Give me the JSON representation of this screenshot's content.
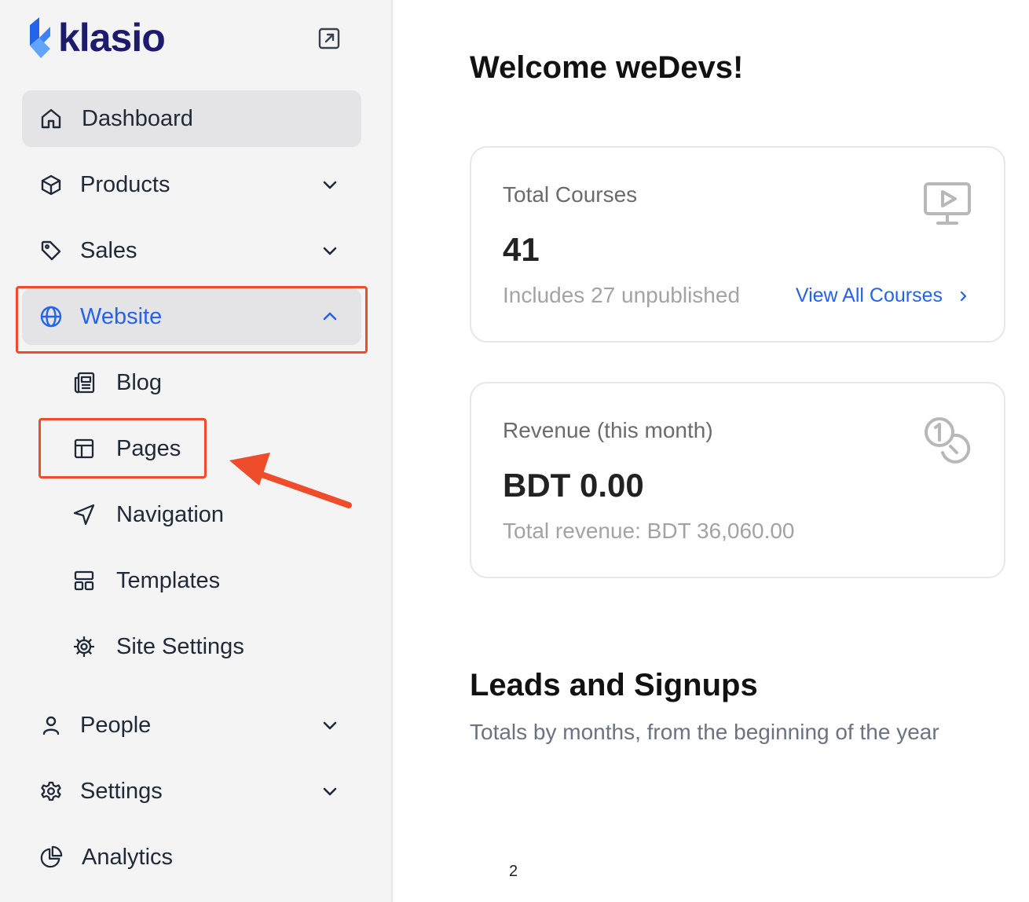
{
  "brand": {
    "name": "klasio",
    "accent": "#2563eb",
    "highlight": "#ef4c2c"
  },
  "sidebar": {
    "items": [
      {
        "label": "Dashboard",
        "icon": "home-icon"
      },
      {
        "label": "Products",
        "icon": "box-icon"
      },
      {
        "label": "Sales",
        "icon": "tag-icon"
      },
      {
        "label": "Website",
        "icon": "globe-icon"
      },
      {
        "label": "People",
        "icon": "user-icon"
      },
      {
        "label": "Settings",
        "icon": "gear-icon"
      },
      {
        "label": "Analytics",
        "icon": "pie-chart-icon"
      }
    ],
    "website_subitems": [
      {
        "label": "Blog",
        "icon": "newspaper-icon"
      },
      {
        "label": "Pages",
        "icon": "layout-icon"
      },
      {
        "label": "Navigation",
        "icon": "navigation-icon"
      },
      {
        "label": "Templates",
        "icon": "templates-icon"
      },
      {
        "label": "Site Settings",
        "icon": "cog-icon"
      }
    ]
  },
  "main": {
    "welcome": "Welcome weDevs!",
    "cards": {
      "courses": {
        "title": "Total Courses",
        "value": "41",
        "subtitle": "Includes 27 unpublished",
        "link": "View All Courses",
        "icon": "monitor-play-icon"
      },
      "revenue": {
        "title": "Revenue (this month)",
        "value": "BDT 0.00",
        "subtitle": "Total revenue: BDT 36,060.00",
        "icon": "coins-icon"
      }
    },
    "leads": {
      "title": "Leads and Signups",
      "subtitle": "Totals by months, from the beginning of the year",
      "tick": "2"
    }
  }
}
